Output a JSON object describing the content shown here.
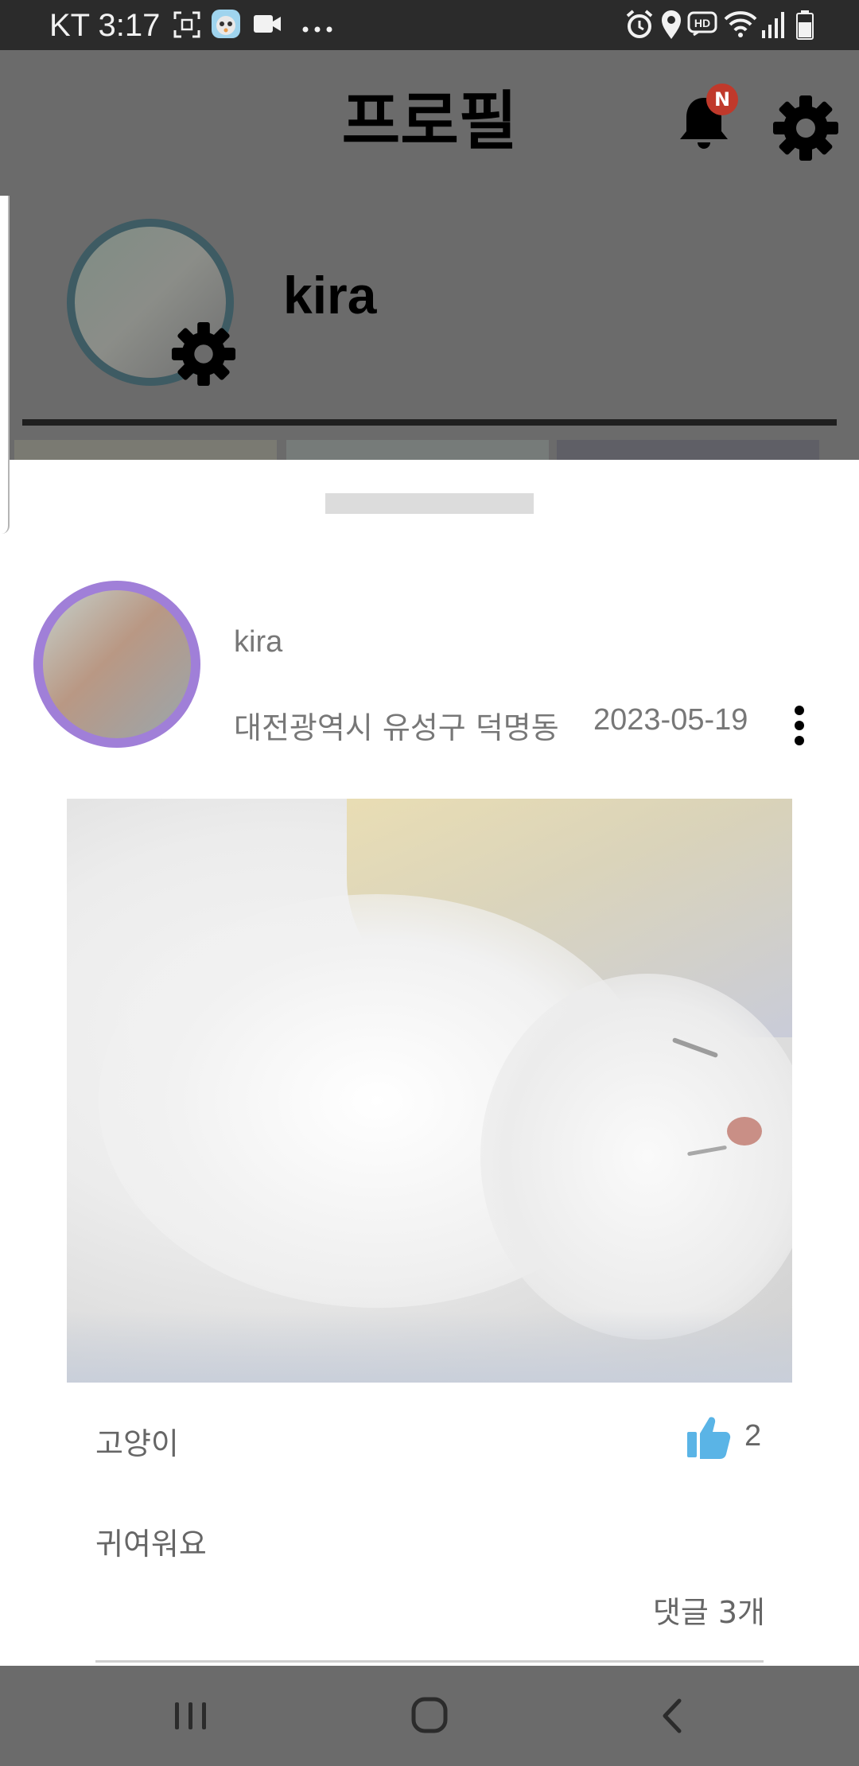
{
  "status_bar": {
    "carrier_time": "KT 3:17",
    "left_icons": [
      "screenshot-icon",
      "app-notification-icon",
      "video-camera-icon",
      "more-dots-icon"
    ],
    "right_icons": [
      "alarm-icon",
      "location-icon",
      "hd-voice-icon",
      "wifi-icon",
      "signal-icon",
      "battery-icon"
    ]
  },
  "header": {
    "title": "프로필",
    "notification_badge": "N"
  },
  "profile": {
    "name": "kira"
  },
  "post": {
    "user": "kira",
    "location": "대전광역시 유성구 덕명동",
    "date": "2023-05-19",
    "category": "고양이",
    "like_count": "2",
    "content": "귀여워요",
    "comment_count": "댓글 3개"
  },
  "colors": {
    "accent_like": "#5ab4e6",
    "post_avatar_ring": "#a07fd8",
    "profile_avatar_ring": "#3e5b63",
    "badge": "#c0392b",
    "scrim": "#6b6b6b"
  },
  "nav": {
    "buttons": [
      "recent-apps-icon",
      "home-icon",
      "back-icon"
    ]
  }
}
